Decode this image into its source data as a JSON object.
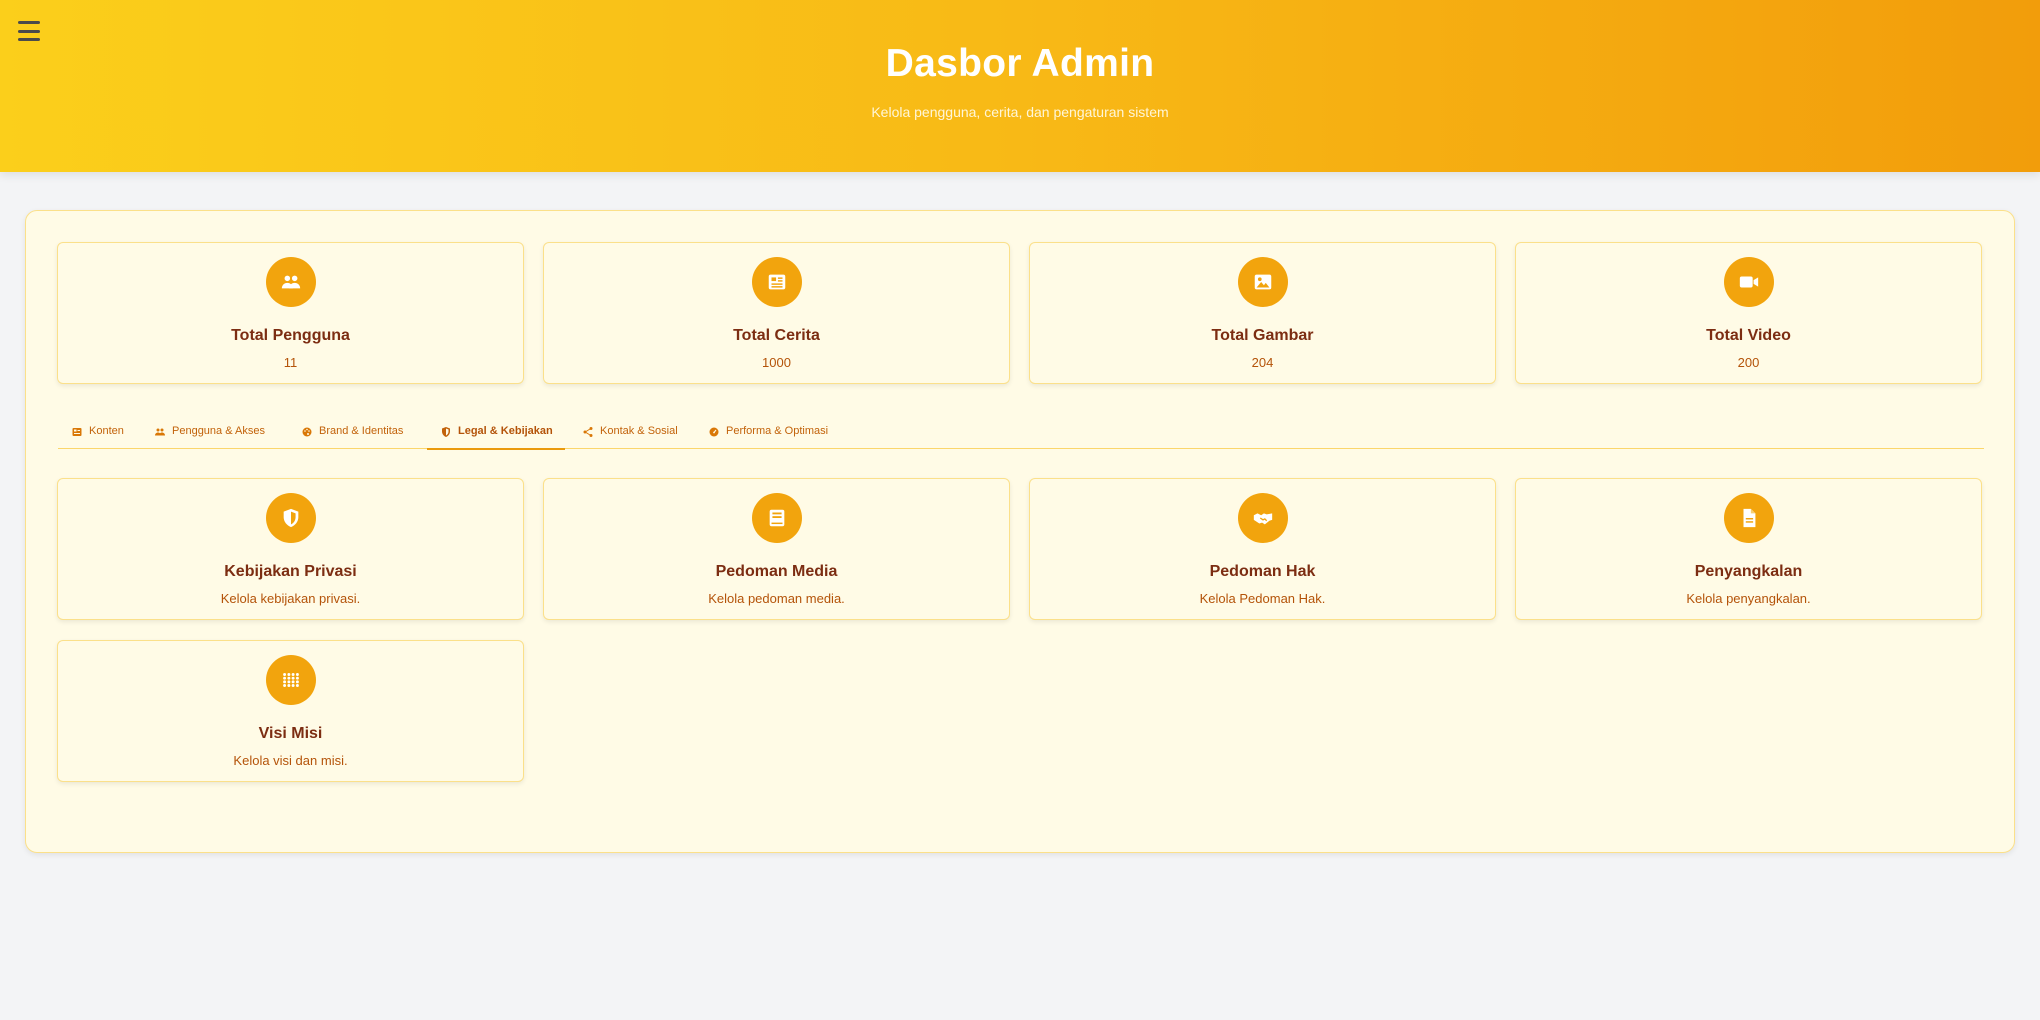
{
  "header": {
    "title": "Dasbor Admin",
    "subtitle": "Kelola pengguna, cerita, dan pengaturan sistem",
    "menu_icon": "hamburger-icon"
  },
  "stats": [
    {
      "title": "Total Pengguna",
      "value": "11",
      "icon": "users-icon"
    },
    {
      "title": "Total Cerita",
      "value": "1000",
      "icon": "newspaper-icon"
    },
    {
      "title": "Total Gambar",
      "value": "204",
      "icon": "image-icon"
    },
    {
      "title": "Total Video",
      "value": "200",
      "icon": "video-icon"
    }
  ],
  "tabs": [
    {
      "label": "Konten",
      "icon": "newspaper-icon",
      "active": false
    },
    {
      "label": "Pengguna & Akses",
      "icon": "users-icon",
      "active": false
    },
    {
      "label": "Brand & Identitas",
      "icon": "palette-icon",
      "active": false
    },
    {
      "label": "Legal & Kebijakan",
      "icon": "shield-icon",
      "active": true
    },
    {
      "label": "Kontak & Sosial",
      "icon": "share-icon",
      "active": false
    },
    {
      "label": "Performa & Optimasi",
      "icon": "gauge-icon",
      "active": false
    }
  ],
  "features": [
    {
      "title": "Kebijakan Privasi",
      "description": "Kelola kebijakan privasi.",
      "icon": "shield-icon"
    },
    {
      "title": "Pedoman Media",
      "description": "Kelola pedoman media.",
      "icon": "book-icon"
    },
    {
      "title": "Pedoman Hak",
      "description": "Kelola Pedoman Hak.",
      "icon": "handshake-icon"
    },
    {
      "title": "Penyangkalan",
      "description": "Kelola penyangkalan.",
      "icon": "file-icon"
    },
    {
      "title": "Visi Misi",
      "description": "Kelola visi dan misi.",
      "icon": "grid-icon"
    }
  ],
  "colors": {
    "accent": "#f2a40d",
    "header_start": "#fbcf1b",
    "header_end": "#f29d0b",
    "card_title": "#7c2d12",
    "card_text": "#b45309",
    "panel_bg": "#fffbe6"
  }
}
